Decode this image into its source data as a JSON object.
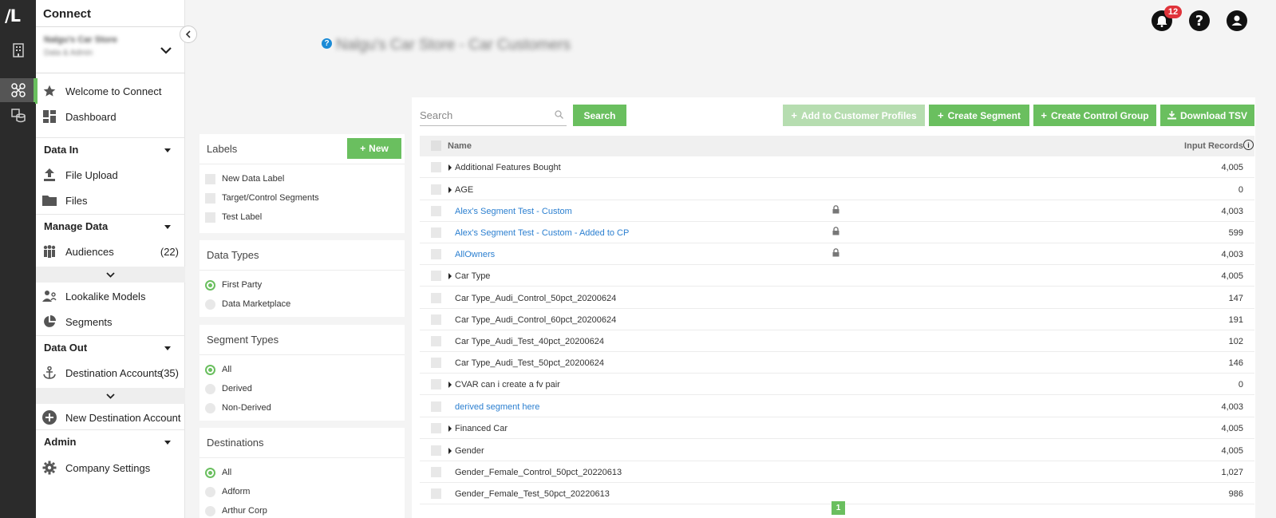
{
  "app": {
    "title": "Connect",
    "logo_text": "/L",
    "store_name": "Nalgu's Car Store",
    "store_sub": "Data & Admin",
    "page_title": "Nalgu's Car Store - Car Customers"
  },
  "topbar": {
    "notification_count": "12",
    "help_dot": "?"
  },
  "sidebar": {
    "items": [
      {
        "label": "Welcome to Connect"
      },
      {
        "label": "Dashboard"
      },
      {
        "section": "Data In"
      },
      {
        "label": "File Upload"
      },
      {
        "label": "Files"
      },
      {
        "section": "Manage Data"
      },
      {
        "label": "Audiences",
        "count": "(22)"
      },
      {
        "label": "Lookalike Models"
      },
      {
        "label": "Segments"
      },
      {
        "section": "Data Out"
      },
      {
        "label": "Destination Accounts",
        "count": "(35)"
      },
      {
        "label": "New Destination Account"
      },
      {
        "section": "Admin"
      },
      {
        "label": "Company Settings"
      }
    ]
  },
  "filters": {
    "labels": {
      "title": "Labels",
      "new_button": "New",
      "options": [
        "New Data Label",
        "Target/Control Segments",
        "Test Label"
      ]
    },
    "data_types": {
      "title": "Data Types",
      "options": [
        "First Party",
        "Data Marketplace"
      ],
      "selected": "First Party"
    },
    "segment_types": {
      "title": "Segment Types",
      "options": [
        "All",
        "Derived",
        "Non-Derived"
      ],
      "selected": "All"
    },
    "destinations": {
      "title": "Destinations",
      "options": [
        "All",
        "Adform",
        "Arthur Corp"
      ],
      "selected": "All"
    }
  },
  "toolbar": {
    "search_placeholder": "Search",
    "search_button": "Search",
    "add_to_profiles": "Add to Customer Profiles",
    "create_segment": "Create Segment",
    "create_control_group": "Create Control Group",
    "download_tsv": "Download TSV"
  },
  "table": {
    "columns": {
      "name": "Name",
      "records": "Input Records"
    },
    "rows": [
      {
        "name": "Additional Features Bought",
        "records": "4,005",
        "expandable": true,
        "link": false,
        "locked": false
      },
      {
        "name": "AGE",
        "records": "0",
        "expandable": true,
        "link": false,
        "locked": false
      },
      {
        "name": "Alex's Segment Test - Custom",
        "records": "4,003",
        "expandable": false,
        "link": true,
        "locked": true
      },
      {
        "name": "Alex's Segment Test - Custom - Added to CP",
        "records": "599",
        "expandable": false,
        "link": true,
        "locked": true
      },
      {
        "name": "AllOwners",
        "records": "4,003",
        "expandable": false,
        "link": true,
        "locked": true
      },
      {
        "name": "Car Type",
        "records": "4,005",
        "expandable": true,
        "link": false,
        "locked": false
      },
      {
        "name": "Car Type_Audi_Control_50pct_20200624",
        "records": "147",
        "expandable": false,
        "link": false,
        "locked": false
      },
      {
        "name": "Car Type_Audi_Control_60pct_20200624",
        "records": "191",
        "expandable": false,
        "link": false,
        "locked": false
      },
      {
        "name": "Car Type_Audi_Test_40pct_20200624",
        "records": "102",
        "expandable": false,
        "link": false,
        "locked": false
      },
      {
        "name": "Car Type_Audi_Test_50pct_20200624",
        "records": "146",
        "expandable": false,
        "link": false,
        "locked": false
      },
      {
        "name": "CVAR can i create a fv pair",
        "records": "0",
        "expandable": true,
        "link": false,
        "locked": false
      },
      {
        "name": "derived segment here",
        "records": "4,003",
        "expandable": false,
        "link": true,
        "locked": false
      },
      {
        "name": "Financed Car",
        "records": "4,005",
        "expandable": true,
        "link": false,
        "locked": false
      },
      {
        "name": "Gender",
        "records": "4,005",
        "expandable": true,
        "link": false,
        "locked": false
      },
      {
        "name": "Gender_Female_Control_50pct_20220613",
        "records": "1,027",
        "expandable": false,
        "link": false,
        "locked": false
      },
      {
        "name": "Gender_Female_Test_50pct_20220613",
        "records": "986",
        "expandable": false,
        "link": false,
        "locked": false
      }
    ]
  },
  "pagination": {
    "current": "1"
  },
  "colors": {
    "accent": "#6abf5f",
    "link": "#2b7fd0",
    "badge": "#e0333a",
    "rail": "#2b2b2b"
  }
}
